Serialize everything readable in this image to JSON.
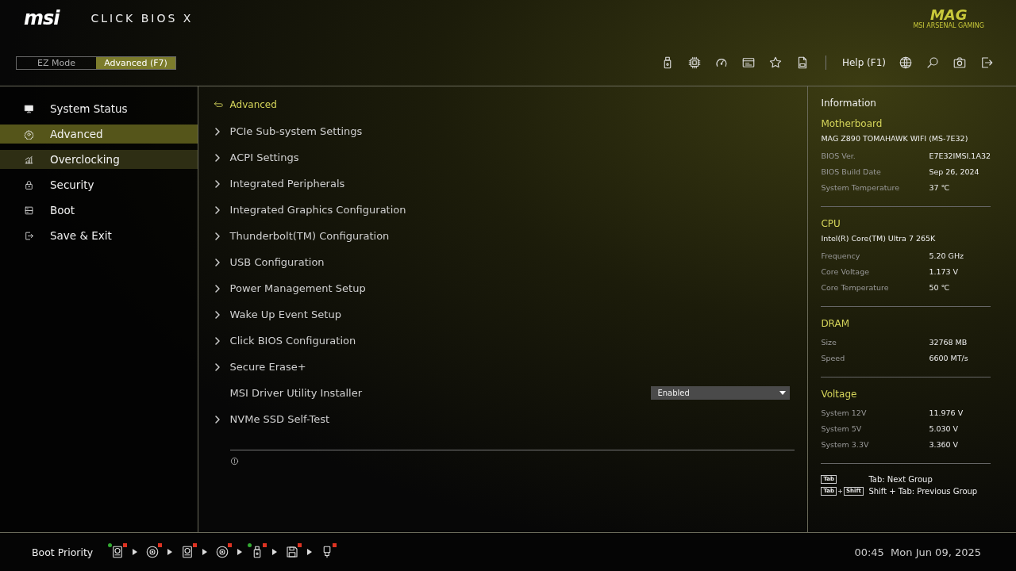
{
  "header": {
    "logo": "msi",
    "product": "CLICK BIOS X",
    "brand": "MAG",
    "brand_sub": "MSI ARSENAL GAMING",
    "modes": [
      {
        "label": "EZ Mode",
        "selected": false
      },
      {
        "label": "Advanced (F7)",
        "selected": true
      }
    ],
    "help": "Help (F1)"
  },
  "sidebar": {
    "items": [
      {
        "label": "System Status",
        "selected": false,
        "hovered": false
      },
      {
        "label": "Advanced",
        "selected": true,
        "hovered": false
      },
      {
        "label": "Overclocking",
        "selected": false,
        "hovered": true
      },
      {
        "label": "Security",
        "selected": false,
        "hovered": false
      },
      {
        "label": "Boot",
        "selected": false,
        "hovered": false
      },
      {
        "label": "Save & Exit",
        "selected": false,
        "hovered": false
      }
    ]
  },
  "main": {
    "breadcrumb": "Advanced",
    "settings": [
      {
        "kind": "submenu",
        "label": "PCIe Sub-system Settings"
      },
      {
        "kind": "submenu",
        "label": "ACPI Settings"
      },
      {
        "kind": "submenu",
        "label": "Integrated Peripherals"
      },
      {
        "kind": "submenu",
        "label": "Integrated Graphics Configuration"
      },
      {
        "kind": "submenu",
        "label": "Thunderbolt(TM) Configuration"
      },
      {
        "kind": "submenu",
        "label": "USB Configuration"
      },
      {
        "kind": "submenu",
        "label": "Power Management Setup"
      },
      {
        "kind": "submenu",
        "label": "Wake Up Event Setup"
      },
      {
        "kind": "submenu",
        "label": "Click BIOS Configuration"
      },
      {
        "kind": "submenu",
        "label": "Secure Erase+"
      },
      {
        "kind": "dropdown",
        "label": "MSI Driver Utility Installer",
        "value": "Enabled"
      },
      {
        "kind": "submenu",
        "label": "NVMe SSD Self-Test"
      }
    ]
  },
  "information": {
    "title": "Information",
    "groups": [
      {
        "heading": "Motherboard",
        "subtitle": "MAG Z890 TOMAHAWK WIFI (MS-7E32)",
        "rows": [
          {
            "label": "BIOS Ver.",
            "value": "E7E32IMSI.1A32"
          },
          {
            "label": "BIOS Build Date",
            "value": "Sep 26, 2024"
          },
          {
            "label": "System Temperature",
            "value": "37 ℃"
          }
        ]
      },
      {
        "heading": "CPU",
        "subtitle": "Intel(R) Core(TM) Ultra 7 265K",
        "rows": [
          {
            "label": "Frequency",
            "value": "5.20 GHz"
          },
          {
            "label": "Core Voltage",
            "value": "1.173 V"
          },
          {
            "label": "Core Temperature",
            "value": "50 ℃"
          }
        ]
      },
      {
        "heading": "DRAM",
        "rows": [
          {
            "label": "Size",
            "value": "32768 MB"
          },
          {
            "label": "Speed",
            "value": "6600 MT/s"
          }
        ]
      },
      {
        "heading": "Voltage",
        "rows": [
          {
            "label": "System 12V",
            "value": "11.976 V"
          },
          {
            "label": "System 5V",
            "value": "5.030 V"
          },
          {
            "label": "System 3.3V",
            "value": "3.360 V"
          }
        ]
      }
    ],
    "shortcuts": [
      {
        "keys": [
          "Tab"
        ],
        "text": "Tab: Next Group"
      },
      {
        "keys": [
          "Tab",
          "Shift"
        ],
        "text": "Shift + Tab: Previous Group"
      }
    ]
  },
  "footer": {
    "boot_label": "Boot Priority",
    "boot_devices": [
      {
        "kind": "hdd",
        "checked": true
      },
      {
        "kind": "disc",
        "checked": false
      },
      {
        "kind": "hdd",
        "checked": false
      },
      {
        "kind": "disc",
        "checked": false
      },
      {
        "kind": "usb",
        "checked": true
      },
      {
        "kind": "floppy",
        "checked": false
      },
      {
        "kind": "network",
        "checked": false
      }
    ],
    "clock": "00:45  Mon Jun 09, 2025"
  }
}
